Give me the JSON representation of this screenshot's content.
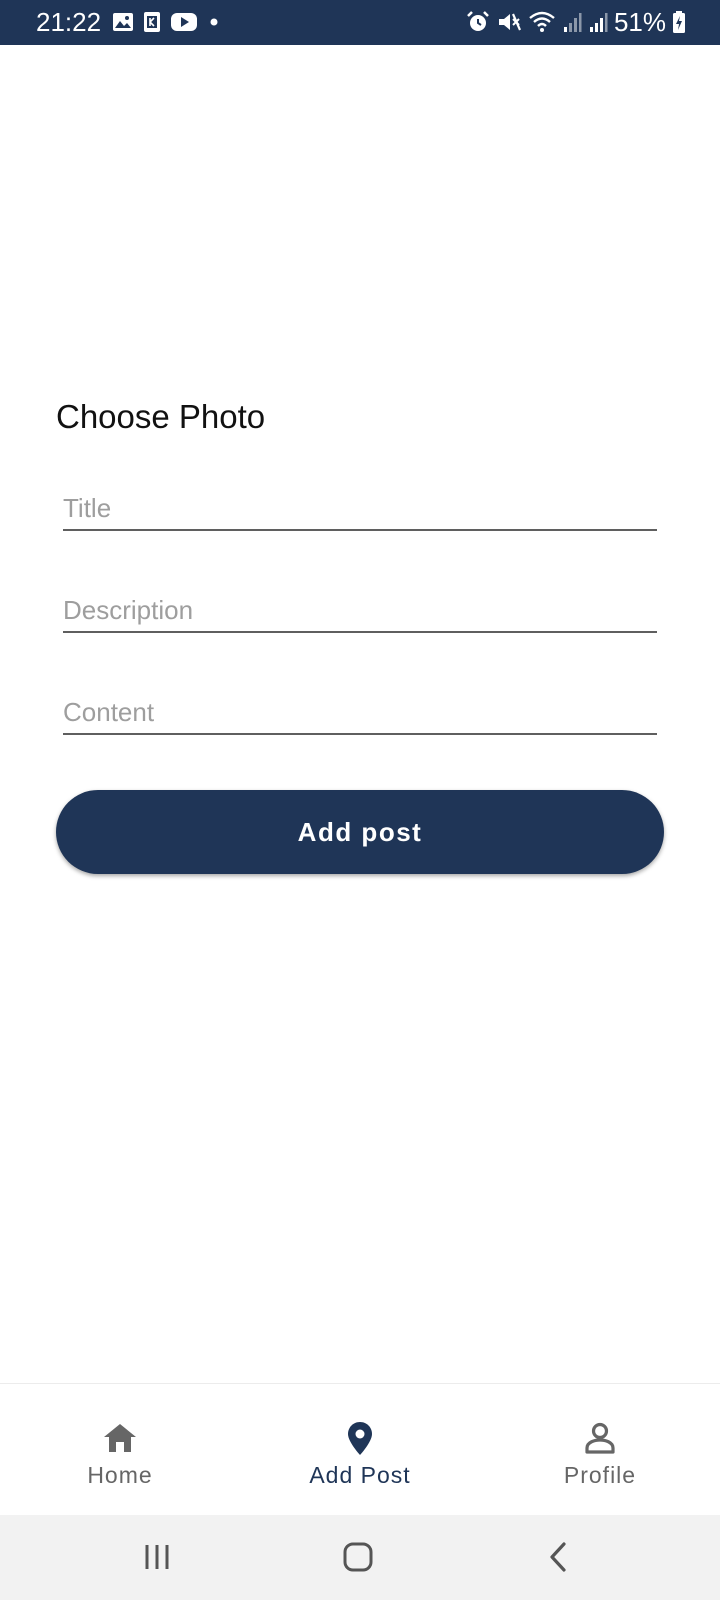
{
  "status_bar": {
    "time": "21:22",
    "battery": "51%",
    "left_icons": [
      "gallery-icon",
      "k-app-icon",
      "youtube-icon",
      "dot-icon"
    ],
    "right_icons": [
      "alarm-icon",
      "mute-icon",
      "wifi-icon",
      "signal-icon",
      "signal-icon",
      "battery-charging-icon"
    ],
    "background": "#1f3557"
  },
  "form": {
    "choose_photo": "Choose Photo",
    "title_placeholder": "Title",
    "description_placeholder": "Description",
    "content_placeholder": "Content",
    "submit_label": "Add post"
  },
  "bottom_nav": {
    "items": [
      {
        "label": "Home",
        "icon": "home-icon",
        "active": false
      },
      {
        "label": "Add Post",
        "icon": "map-pin-icon",
        "active": true
      },
      {
        "label": "Profile",
        "icon": "person-icon",
        "active": false
      }
    ],
    "active_color": "#1f3557",
    "inactive_color": "#666666"
  },
  "system_nav": {
    "icons": [
      "recents-icon",
      "home-button-icon",
      "back-icon"
    ]
  }
}
